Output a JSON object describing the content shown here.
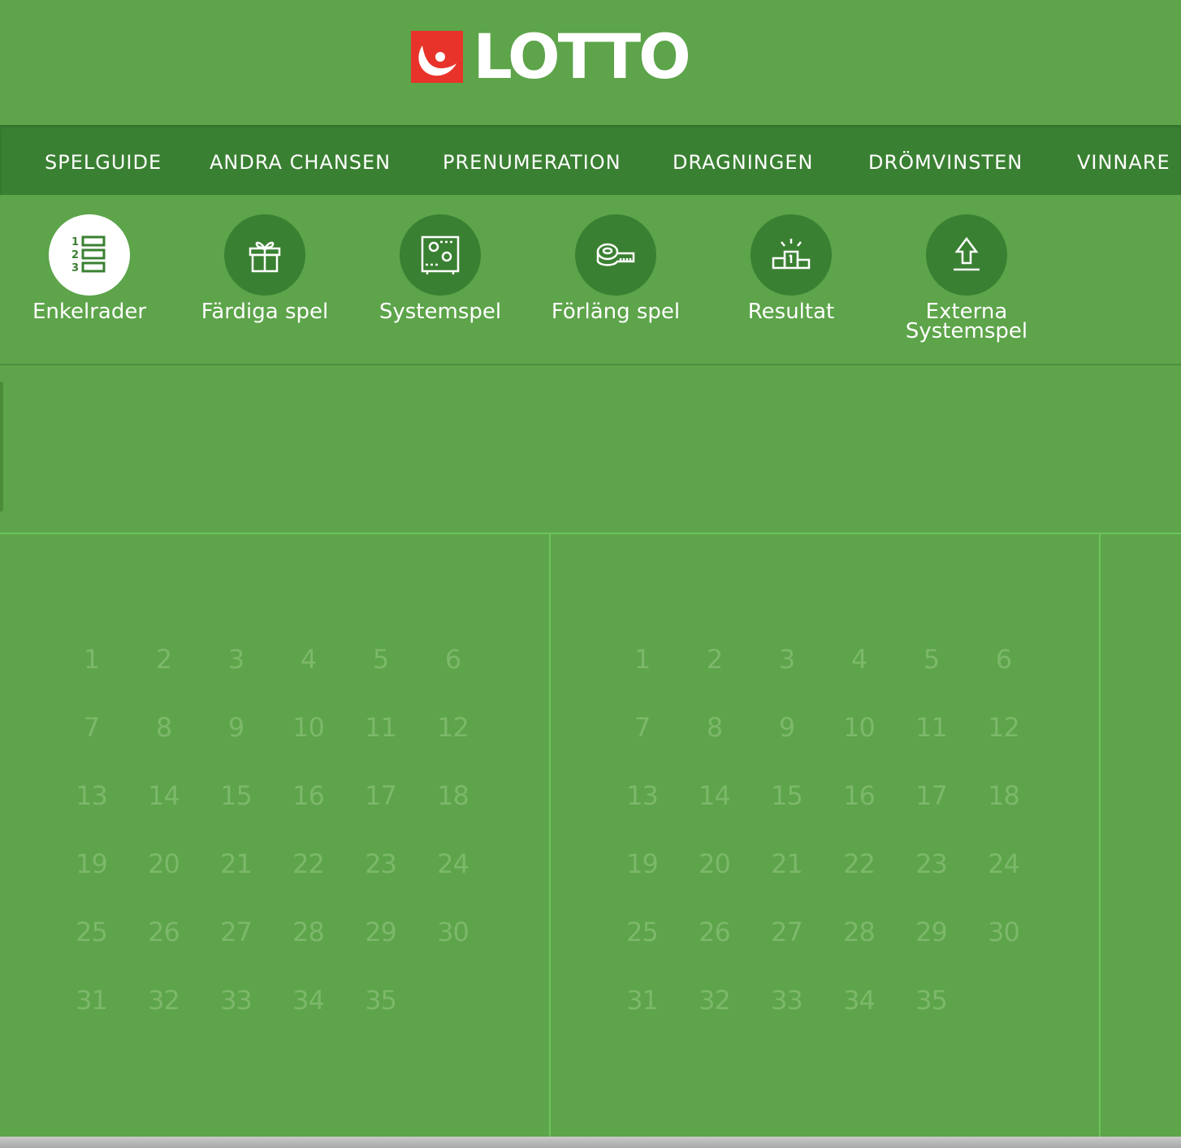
{
  "brand": {
    "name": "LOTTO",
    "logo_color": "#e8332a"
  },
  "nav": {
    "items": [
      "SPELGUIDE",
      "ANDRA CHANSEN",
      "PRENUMERATION",
      "DRAGNINGEN",
      "DRÖMVINSTEN",
      "VINNARE"
    ]
  },
  "tabs": [
    {
      "label": "Enkelrader",
      "icon": "numbered-list-icon",
      "active": true
    },
    {
      "label": "Färdiga spel",
      "icon": "gift-icon",
      "active": false
    },
    {
      "label": "Systemspel",
      "icon": "system-gears-icon",
      "active": false
    },
    {
      "label": "Förläng spel",
      "icon": "tape-measure-icon",
      "active": false
    },
    {
      "label": "Resultat",
      "icon": "podium-icon",
      "active": false
    },
    {
      "label": "Externa Systemspel",
      "icon": "upload-arrow-icon",
      "active": false
    }
  ],
  "coupons": [
    {
      "numbers": [
        1,
        2,
        3,
        4,
        5,
        6,
        7,
        8,
        9,
        10,
        11,
        12,
        13,
        14,
        15,
        16,
        17,
        18,
        19,
        20,
        21,
        22,
        23,
        24,
        25,
        26,
        27,
        28,
        29,
        30,
        31,
        32,
        33,
        34,
        35
      ]
    },
    {
      "numbers": [
        1,
        2,
        3,
        4,
        5,
        6,
        7,
        8,
        9,
        10,
        11,
        12,
        13,
        14,
        15,
        16,
        17,
        18,
        19,
        20,
        21,
        22,
        23,
        24,
        25,
        26,
        27,
        28,
        29,
        30,
        31,
        32,
        33,
        34,
        35
      ]
    }
  ],
  "colors": {
    "background": "#5da44a",
    "nav": "#3a8032",
    "number": "#7cb86a"
  }
}
